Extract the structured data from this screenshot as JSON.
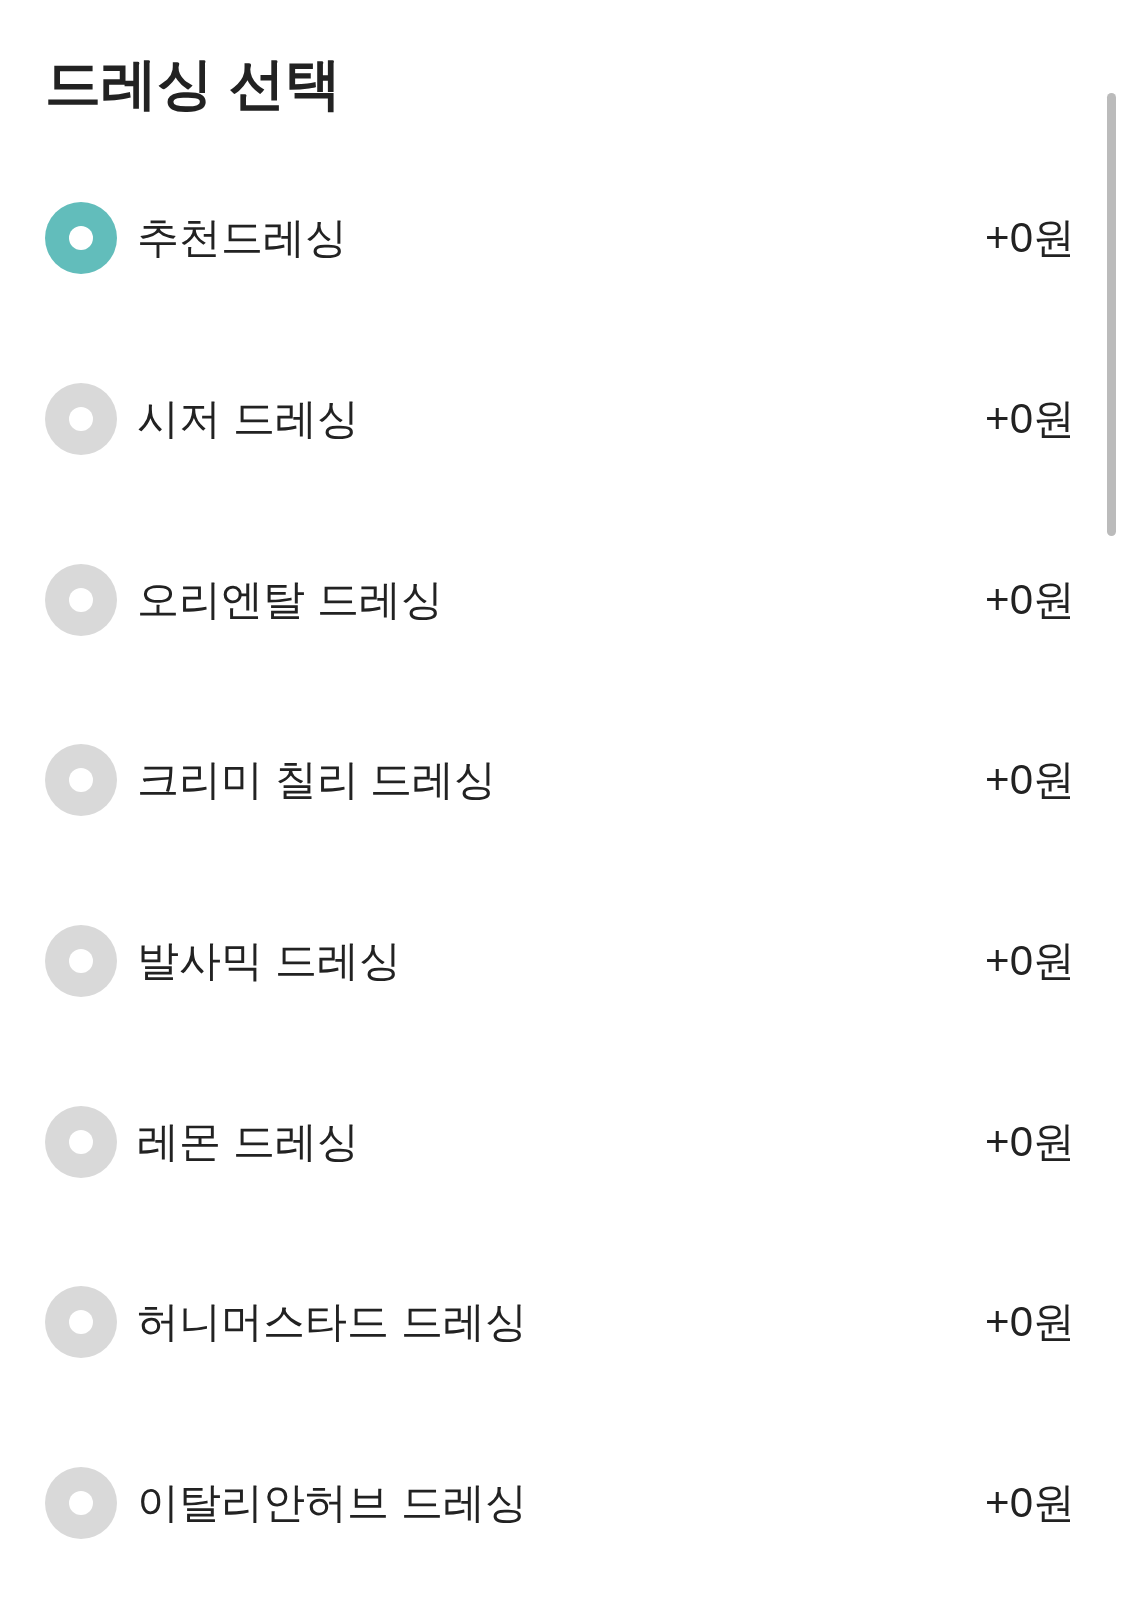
{
  "title": "드레싱 선택",
  "options": [
    {
      "label": "추천드레싱",
      "price": "+0원",
      "selected": true
    },
    {
      "label": "시저 드레싱",
      "price": "+0원",
      "selected": false
    },
    {
      "label": "오리엔탈 드레싱",
      "price": "+0원",
      "selected": false
    },
    {
      "label": "크리미 칠리 드레싱",
      "price": "+0원",
      "selected": false
    },
    {
      "label": "발사믹 드레싱",
      "price": "+0원",
      "selected": false
    },
    {
      "label": "레몬 드레싱",
      "price": "+0원",
      "selected": false
    },
    {
      "label": "허니머스타드 드레싱",
      "price": "+0원",
      "selected": false
    },
    {
      "label": "이탈리안허브 드레싱",
      "price": "+0원",
      "selected": false
    }
  ]
}
